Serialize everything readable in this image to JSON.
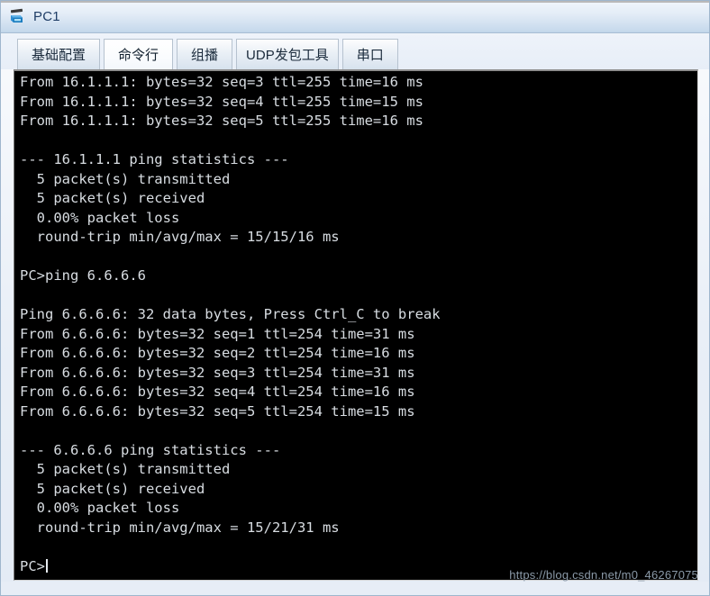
{
  "window": {
    "title": "PC1",
    "icon": "pc-device-icon"
  },
  "tabs": [
    {
      "label": "基础配置",
      "active": false,
      "name": "tab-basic-config"
    },
    {
      "label": "命令行",
      "active": true,
      "name": "tab-command-line"
    },
    {
      "label": "组播",
      "active": false,
      "name": "tab-multicast"
    },
    {
      "label": "UDP发包工具",
      "active": false,
      "name": "tab-udp-tool"
    },
    {
      "label": "串口",
      "active": false,
      "name": "tab-serial-port"
    }
  ],
  "terminal": {
    "lines": [
      "From 16.1.1.1: bytes=32 seq=3 ttl=255 time=16 ms",
      "From 16.1.1.1: bytes=32 seq=4 ttl=255 time=15 ms",
      "From 16.1.1.1: bytes=32 seq=5 ttl=255 time=16 ms",
      "",
      "--- 16.1.1.1 ping statistics ---",
      "  5 packet(s) transmitted",
      "  5 packet(s) received",
      "  0.00% packet loss",
      "  round-trip min/avg/max = 15/15/16 ms",
      "",
      "PC>ping 6.6.6.6",
      "",
      "Ping 6.6.6.6: 32 data bytes, Press Ctrl_C to break",
      "From 6.6.6.6: bytes=32 seq=1 ttl=254 time=31 ms",
      "From 6.6.6.6: bytes=32 seq=2 ttl=254 time=16 ms",
      "From 6.6.6.6: bytes=32 seq=3 ttl=254 time=31 ms",
      "From 6.6.6.6: bytes=32 seq=4 ttl=254 time=16 ms",
      "From 6.6.6.6: bytes=32 seq=5 ttl=254 time=15 ms",
      "",
      "--- 6.6.6.6 ping statistics ---",
      "  5 packet(s) transmitted",
      "  5 packet(s) received",
      "  0.00% packet loss",
      "  round-trip min/avg/max = 15/21/31 ms",
      "",
      "PC>"
    ],
    "prompt": "PC>",
    "colors": {
      "background": "#000000",
      "text": "#d8dde2"
    }
  },
  "watermark": {
    "text": "https://blog.csdn.net/m0_46267075"
  }
}
